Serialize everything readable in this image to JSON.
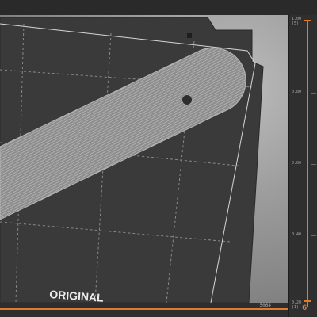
{
  "viewport": {
    "bed_label": "ORIGINAL"
  },
  "layer_slider": {
    "top_value": "1.00",
    "top_layer": "(5)",
    "ticks": [
      "0.80",
      "0.60",
      "0.40"
    ],
    "bottom_value": "0.20",
    "bottom_layer": "(1)",
    "bottom_marker": "6"
  },
  "horizontal_slider": {
    "value": "5064"
  },
  "colors": {
    "accent": "#e07a2c",
    "bed": "#3a3a3a",
    "model": "#9a9a9a"
  }
}
